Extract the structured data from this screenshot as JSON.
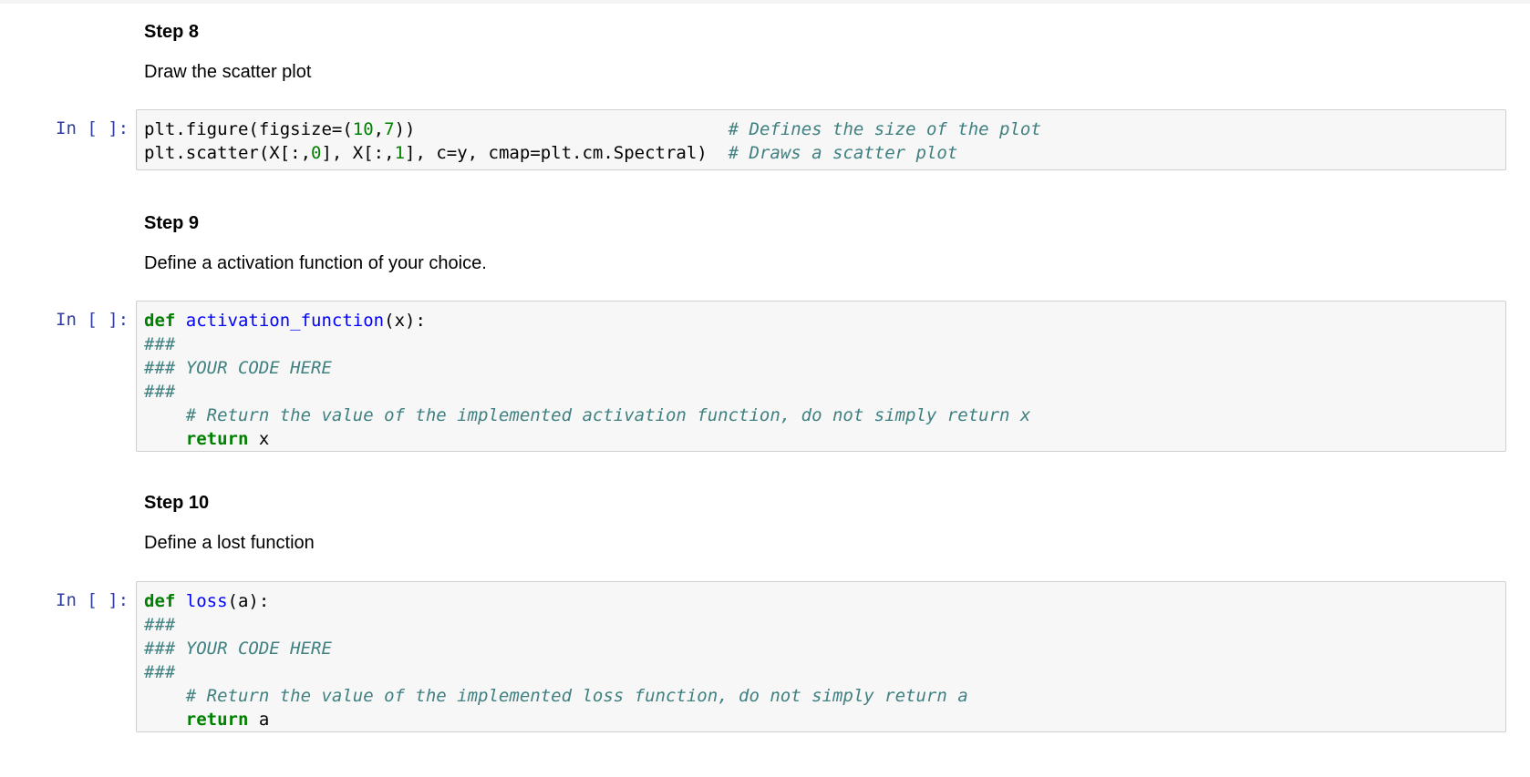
{
  "step8": {
    "heading": "Step 8",
    "text": "Draw the scatter plot",
    "prompt": "In [ ]:",
    "line1_a": "plt.figure(figsize=(",
    "line1_n1": "10",
    "line1_b": ",",
    "line1_n2": "7",
    "line1_c": "))                              ",
    "line1_comment": "# Defines the size of the plot",
    "line2_a": "plt.scatter(X[:,",
    "line2_n1": "0",
    "line2_b": "], X[:,",
    "line2_n2": "1",
    "line2_c": "], c=y, cmap=plt.cm.Spectral)  ",
    "line2_comment": "# Draws a scatter plot"
  },
  "step9": {
    "heading": "Step 9",
    "text": "Define a activation function of your choice.",
    "prompt": "In [ ]:",
    "def_kw": "def",
    "fn_name": "activation_function",
    "fn_args": "(x):",
    "c1": "###",
    "c2": "### YOUR CODE HERE",
    "c3": "###",
    "c4": "# Return the value of the implemented activation function, do not simply return x",
    "return_kw": "return",
    "return_val": " x"
  },
  "step10": {
    "heading": "Step 10",
    "text": "Define a lost function",
    "prompt": "In [ ]:",
    "def_kw": "def",
    "fn_name": "loss",
    "fn_args": "(a):",
    "c1": "###",
    "c2": "### YOUR CODE HERE",
    "c3": "###",
    "c4": "# Return the value of the implemented loss function, do not simply return a",
    "return_kw": "return",
    "return_val": " a"
  }
}
